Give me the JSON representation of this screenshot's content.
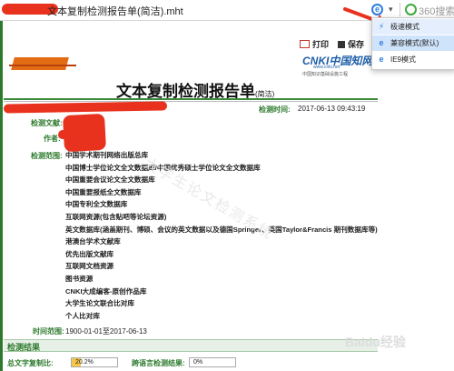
{
  "browser": {
    "title": "文本复制检测报告单(简洁).mht",
    "search_placeholder": "360搜索",
    "ie_icon": "ie-icon",
    "caret": "▾"
  },
  "mode_menu": {
    "items": [
      {
        "label": "极速模式",
        "icon": "bolt-icon",
        "state": "hover"
      },
      {
        "label": "兼容模式(默认)",
        "icon": "ie-icon",
        "state": "selected"
      },
      {
        "label": "IE9模式",
        "icon": "ie-icon",
        "state": "normal"
      }
    ]
  },
  "toolbar": {
    "print_label": "打印",
    "save_label": "保存"
  },
  "cnki": {
    "logo_text": "CNKI中国知网",
    "url": "www.cnki.net",
    "subtitle": "中国知识基础设施工程"
  },
  "report": {
    "title": "文本复制检测报告单",
    "title_suffix": "(简洁)",
    "check_time_label": "检测时间:",
    "check_time": "2017-06-13 09:43:19",
    "doc_label": "检测文献:",
    "author_label": "作者:",
    "scope_label": "检测范围:",
    "scope": [
      "中国学术期刊网络出版总库",
      "中国博士学位论文全文数据库/中国优秀硕士学位论文全文数据库",
      "中国重要会议论文全文数据库",
      "中国重要报纸全文数据库",
      "中国专利全文数据库",
      "互联网资源(包含贴吧等论坛资源)",
      "英文数据库(涵盖期刊、博硕、会议的英文数据以及德国Springer、英国Taylor&Francis 期刊数据库等)",
      "港澳台学术文献库",
      "优先出版文献库",
      "互联网文档资源",
      "图书资源",
      "CNKI大成编客-原创作品库",
      "大学生论文联合比对库",
      "个人比对库"
    ],
    "time_range_label": "时间范围:",
    "time_range": "1900-01-01至2017-06-13",
    "watermark": "大学生论文检测系统",
    "results_title": "检测结果",
    "similarity_label": "总文字复制比:",
    "similarity_value": "20.2%",
    "similarity_fraction": 0.202,
    "cross_lang_label": "跨语言检测结果:",
    "cross_lang_value": "0%",
    "baidu_watermark": "Baidu经验"
  },
  "colors": {
    "accent_green": "#2d7a2d",
    "menu_selected": "#cfe3fb",
    "redaction": "#e8321e",
    "ie_blue": "#2d7de0"
  }
}
